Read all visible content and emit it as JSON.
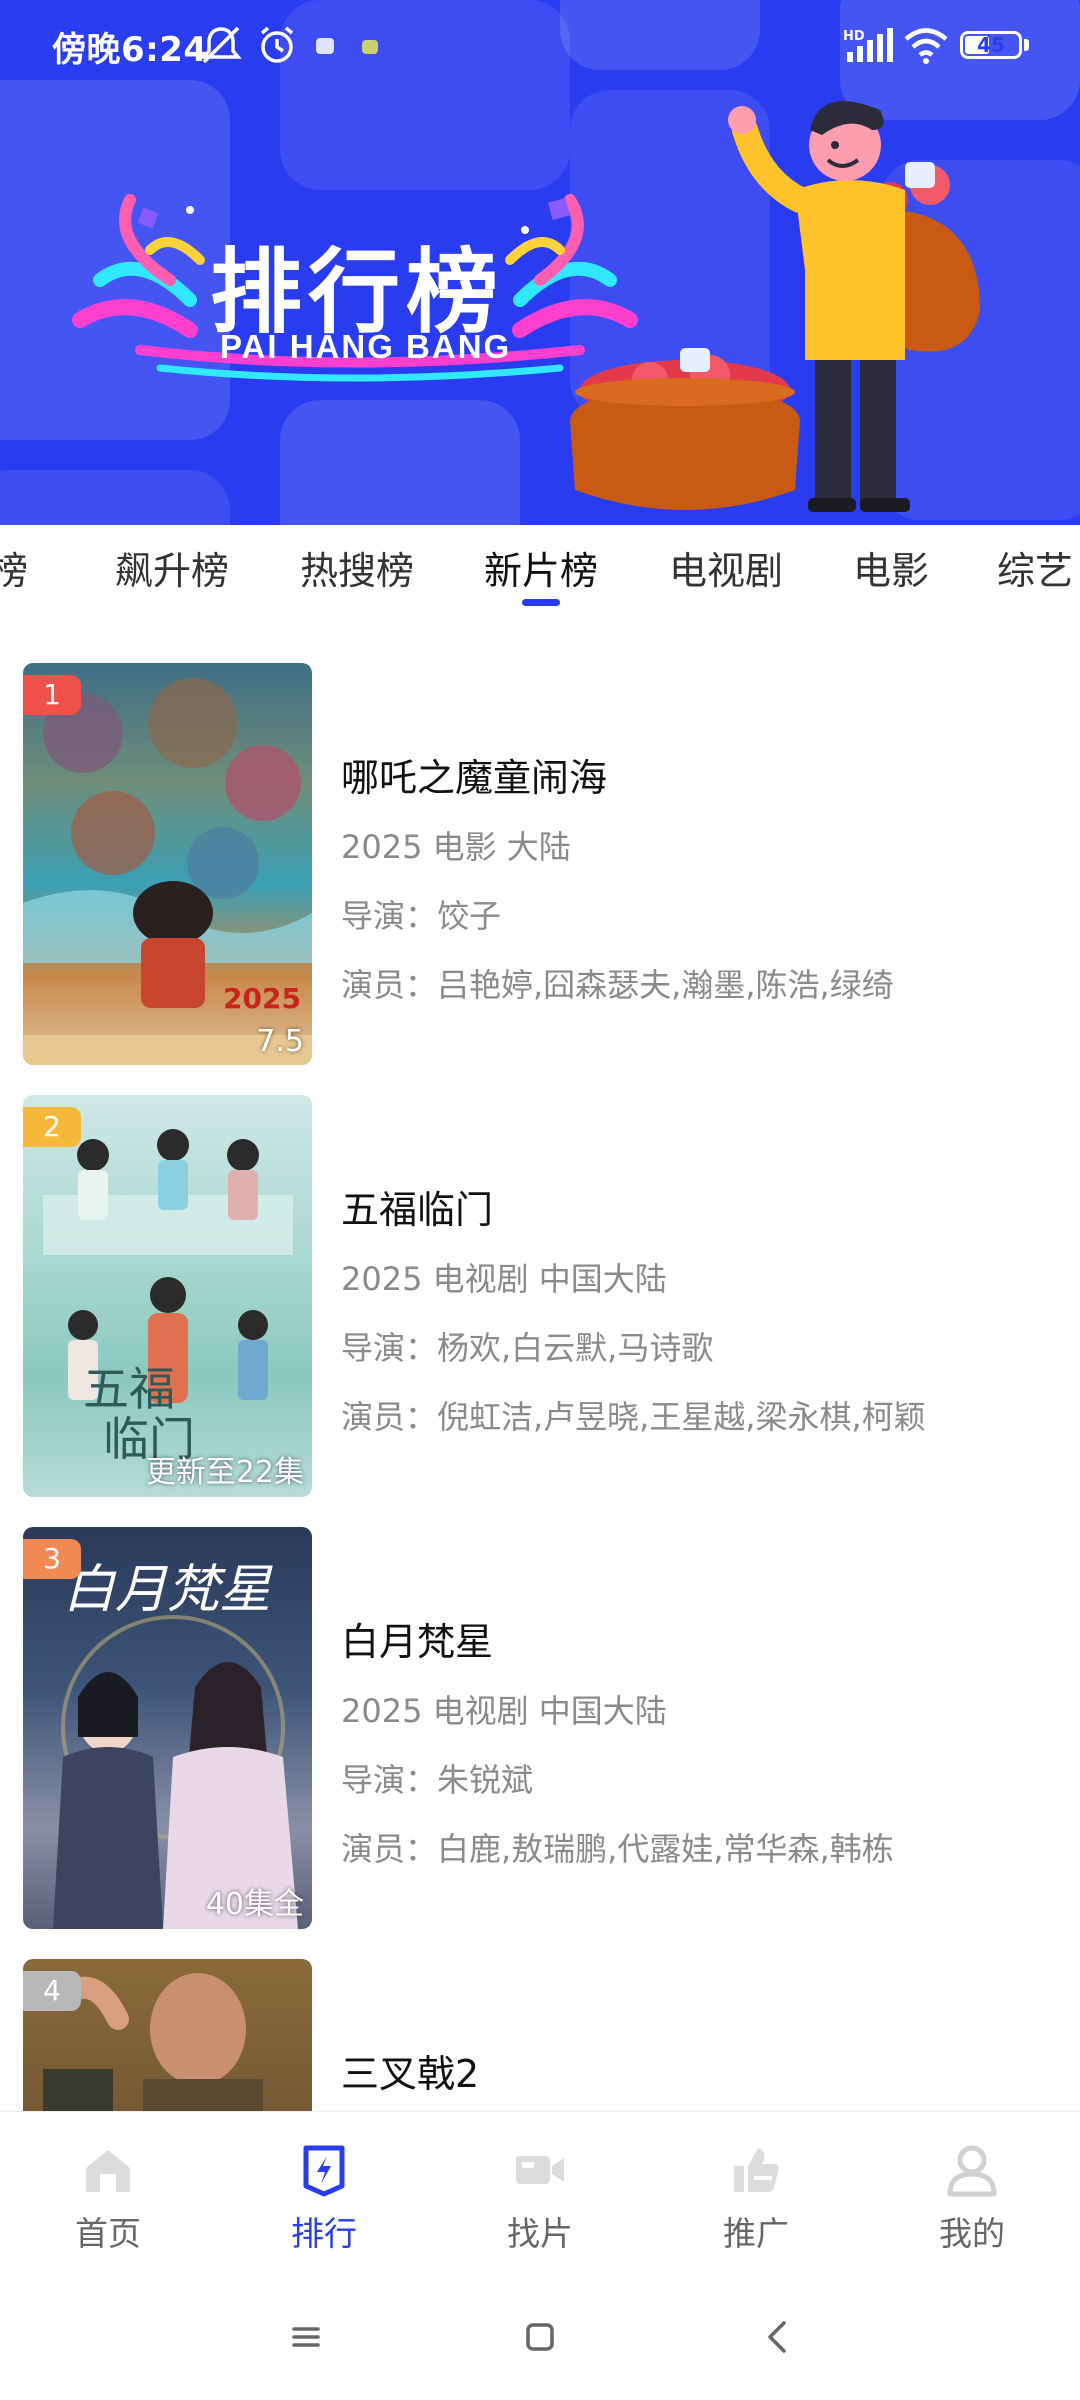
{
  "status_bar": {
    "time": "傍晚6:24",
    "hd_label": "HD",
    "battery": "45"
  },
  "banner": {
    "title_cn": "排行榜",
    "title_en": "PAI HANG BANG"
  },
  "tabs": [
    {
      "label": "榜"
    },
    {
      "label": "飙升榜"
    },
    {
      "label": "热搜榜"
    },
    {
      "label": "新片榜",
      "active": true
    },
    {
      "label": "电视剧"
    },
    {
      "label": "电影"
    },
    {
      "label": "综艺"
    }
  ],
  "list": [
    {
      "rank": "1",
      "title": "哪吒之魔童闹海",
      "meta": "2025 电影 大陆",
      "director": "导演：饺子",
      "cast": "演员：吕艳婷,囧森瑟夫,瀚墨,陈浩,绿绮",
      "poster_tag": "7.5",
      "rank_color": "#f0504a"
    },
    {
      "rank": "2",
      "title": "五福临门",
      "meta": "2025 电视剧 中国大陆",
      "director": "导演：杨欢,白云默,马诗歌",
      "cast": "演员：倪虹洁,卢昱晓,王星越,梁永棋,柯颖",
      "poster_tag": "更新至22集",
      "rank_color": "#f5b83b"
    },
    {
      "rank": "3",
      "title": "白月梵星",
      "meta": "2025 电视剧 中国大陆",
      "director": "导演：朱锐斌",
      "cast": "演员：白鹿,敖瑞鹏,代露娃,常华森,韩栋",
      "poster_tag": "40集全",
      "rank_color": "#f08a52"
    },
    {
      "rank": "4",
      "title": "三叉戟2",
      "meta": "",
      "director": "",
      "cast": "",
      "poster_tag": "",
      "rank_color": "#b8b8b8"
    }
  ],
  "bottom_nav": [
    {
      "label": "首页",
      "icon": "home-icon"
    },
    {
      "label": "排行",
      "icon": "ranking-icon",
      "active": true
    },
    {
      "label": "找片",
      "icon": "video-camera-icon"
    },
    {
      "label": "推广",
      "icon": "thumbs-up-icon"
    },
    {
      "label": "我的",
      "icon": "user-icon"
    }
  ],
  "colors": {
    "accent": "#2a3cf0",
    "rank1": "#f0504a",
    "rank2": "#f5b83b",
    "rank3": "#f08a52",
    "rank4": "#b8b8b8"
  }
}
